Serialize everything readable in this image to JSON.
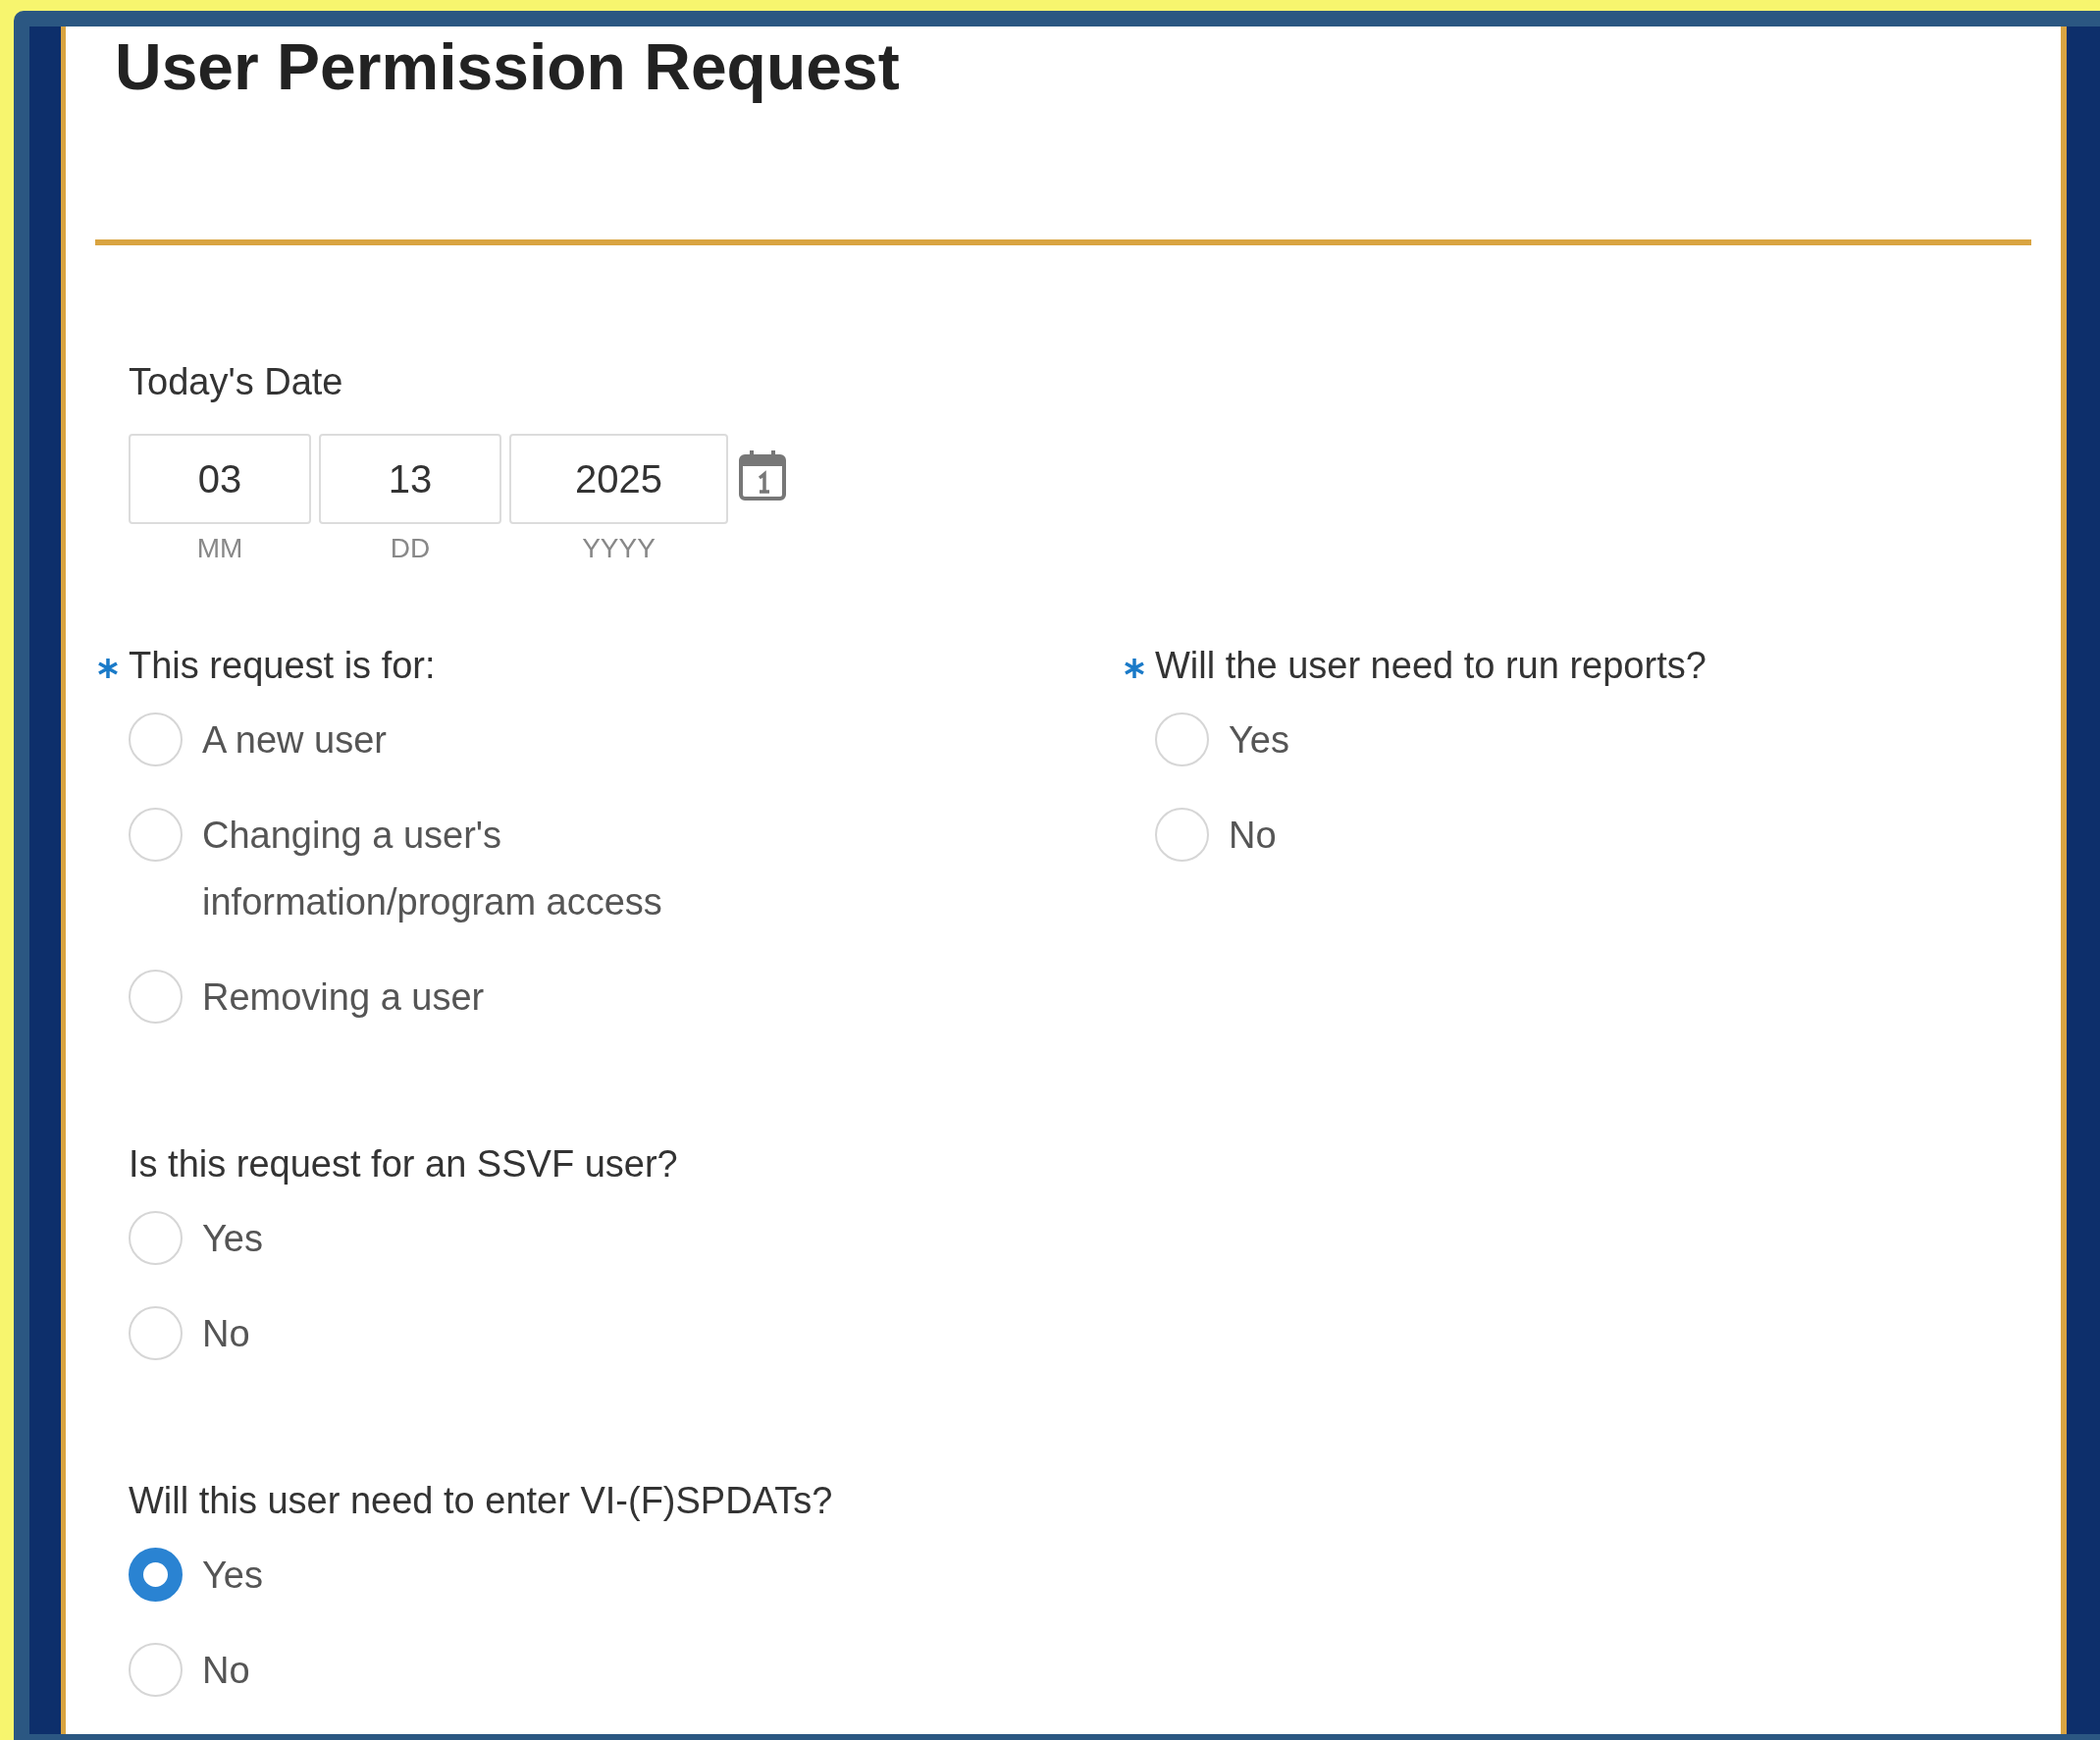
{
  "title": "User Permission Request",
  "date_field": {
    "label": "Today's Date",
    "parts": [
      {
        "value": "03",
        "caption": "MM"
      },
      {
        "value": "13",
        "caption": "DD"
      },
      {
        "value": "2025",
        "caption": "YYYY"
      }
    ]
  },
  "question_rows": [
    {
      "questions": [
        {
          "label": "This request is for:",
          "required": true,
          "options": [
            {
              "label": "A new user",
              "selected": false
            },
            {
              "label": "Changing a user's information/program access",
              "selected": false
            },
            {
              "label": "Removing a user",
              "selected": false
            }
          ]
        },
        {
          "label": "Will the user need to run reports?",
          "required": true,
          "options": [
            {
              "label": "Yes",
              "selected": false
            },
            {
              "label": "No",
              "selected": false
            }
          ]
        }
      ]
    },
    {
      "questions": [
        {
          "label": "Is this request for an SSVF user?",
          "required": false,
          "options": [
            {
              "label": "Yes",
              "selected": false
            },
            {
              "label": "No",
              "selected": false
            }
          ]
        }
      ]
    },
    {
      "questions": [
        {
          "label": "Will this user need to enter VI-(F)SPDATs?",
          "required": false,
          "options": [
            {
              "label": "Yes",
              "selected": true
            },
            {
              "label": "No",
              "selected": false
            }
          ]
        }
      ]
    }
  ]
}
